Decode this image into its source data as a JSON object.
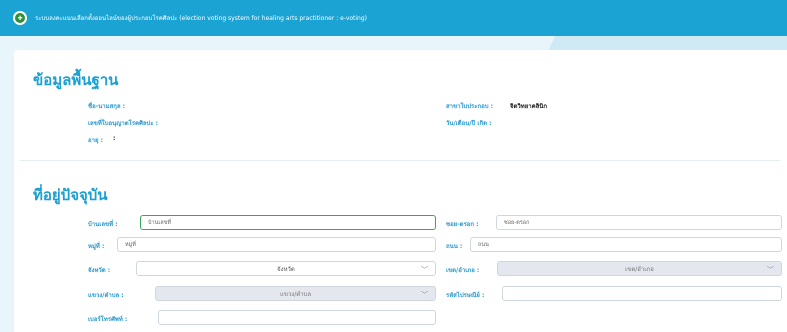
{
  "header": {
    "logo_text": "✚",
    "title": "ระบบลงคะแนนเลือกตั้งออนไลน์ของผู้ประกอบโรคศิลปะ (election voting system for healing arts practitioner : e-voting)"
  },
  "basic_info": {
    "section_title": "ข้อมูลพื้นฐาน",
    "name_label": "ชื่อ-นามสกุล :",
    "name_value": "",
    "license_label": "เลขที่ใบอนุญาตโรคศิลปะ :",
    "license_value": "",
    "age_label": "อายุ :",
    "age_value": ":",
    "branch_label": "สาขาใบประกอบ :",
    "branch_value": "จิตวิทยาคลินิก",
    "dob_label": "วัน/เดือน/ปี เกิด :",
    "dob_value": ""
  },
  "address": {
    "section_title": "ที่อยู่ปัจจุบัน",
    "house_no": {
      "label": "บ้านเลขที่ :",
      "placeholder": "บ้านเลขที่"
    },
    "soi": {
      "label": "ซอย-ตรอก :",
      "placeholder": "ซอย-ตรอก"
    },
    "moo": {
      "label": "หมู่ที่ :",
      "placeholder": "หมู่ที่"
    },
    "road": {
      "label": "ถนน :",
      "placeholder": "ถนน"
    },
    "province": {
      "label": "จังหวัด :",
      "value": "จังหวัด"
    },
    "district": {
      "label": "เขต/อำเภอ :",
      "value": "เขต/อำเภอ"
    },
    "subdistrict": {
      "label": "แขวง/ตำบล :",
      "value": "แขวง/ตำบล"
    },
    "postcode": {
      "label": "รหัสไปรษณีย์ :",
      "placeholder": ""
    },
    "phone": {
      "label": "เบอร์โทรศัพท์ :",
      "placeholder": ""
    }
  },
  "icons": {
    "chevron": "chevron-down-icon"
  }
}
